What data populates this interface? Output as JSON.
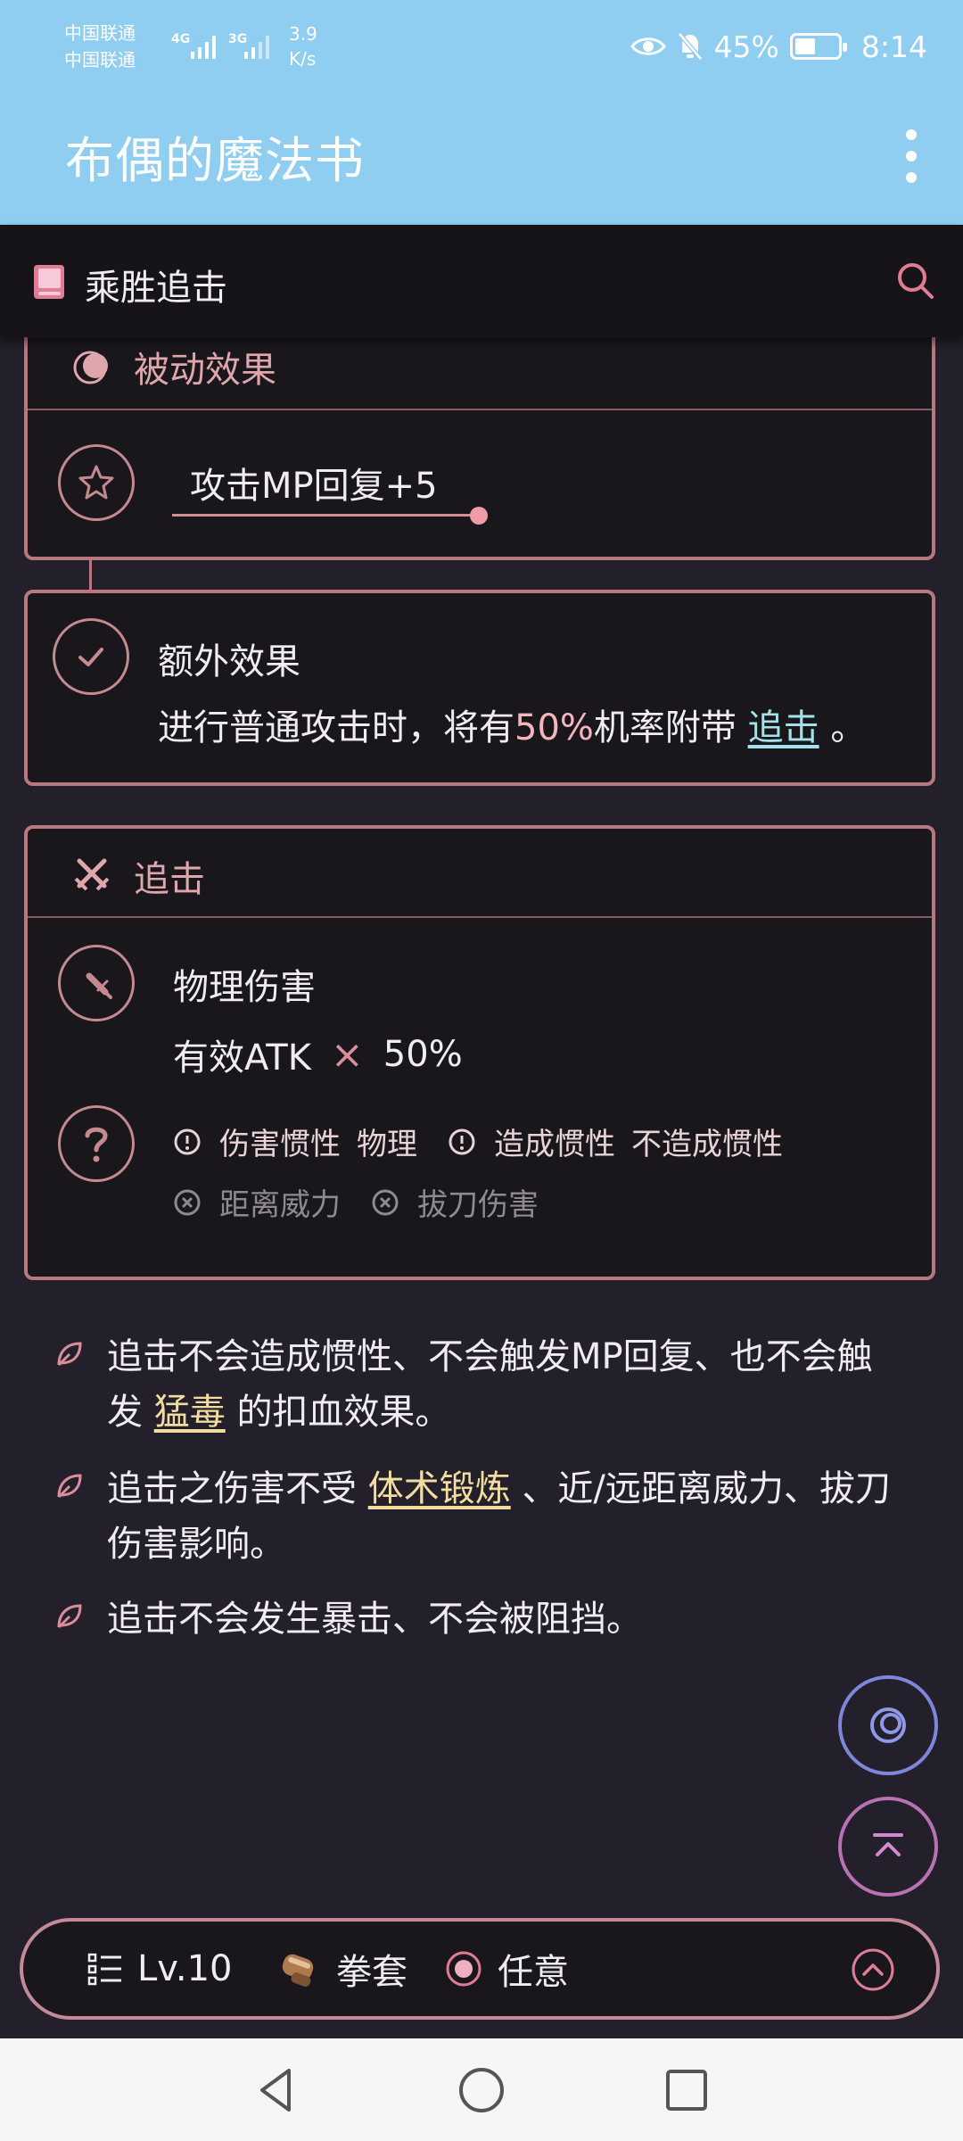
{
  "status_bar": {
    "carrier1": "中国联通",
    "carrier2": "中国联通",
    "sig1": "4G",
    "sig2": "3G",
    "speed_value": "3.9",
    "speed_unit": "K/s",
    "battery": "45%",
    "time": "8:14"
  },
  "app_bar": {
    "title": "布偶的魔法书",
    "menu_icon": "more-vert-icon"
  },
  "sub_header": {
    "title": "乘胜追击",
    "book_icon": "book-icon",
    "search_icon": "search-icon"
  },
  "passive": {
    "label": "被动效果",
    "effect": "攻击MP回复+5"
  },
  "extra": {
    "title": "额外效果",
    "desc_prefix": "进行普通攻击时，将有",
    "desc_rate": "50%",
    "desc_mid": "机率附带",
    "desc_link": "追击",
    "desc_suffix": "。"
  },
  "chase": {
    "label": "追击",
    "damage_type": "物理伤害",
    "formula_base": "有效ATK",
    "formula_op": "×",
    "formula_rate": "50%",
    "tags_row1": [
      {
        "label": "伤害惯性",
        "value": "物理"
      },
      {
        "label": "造成惯性",
        "value": "不造成惯性"
      }
    ],
    "tags_row2": [
      {
        "label": "距离威力"
      },
      {
        "label": "拔刀伤害"
      }
    ]
  },
  "notes": [
    {
      "pre": "追击不会造成惯性、不会触发MP回复、也不会触发",
      "link": "猛毒",
      "post": "的扣血效果。"
    },
    {
      "pre": "追击之伤害不受",
      "link": "体术锻炼",
      "post": "、近/远距离威力、拔刀伤害影响。"
    },
    {
      "pre": "追击不会发生暴击、不会被阻挡。",
      "link": "",
      "post": ""
    }
  ],
  "bottom_bar": {
    "level": "Lv.10",
    "weapon": "拳套",
    "target": "任意"
  },
  "colors": {
    "accent": "#b9787f",
    "appbar": "#8fcdf1",
    "background": "#231f2b",
    "card": "#19171b",
    "link_teal": "#a3e2ea",
    "link_gold": "#f2dca0"
  }
}
